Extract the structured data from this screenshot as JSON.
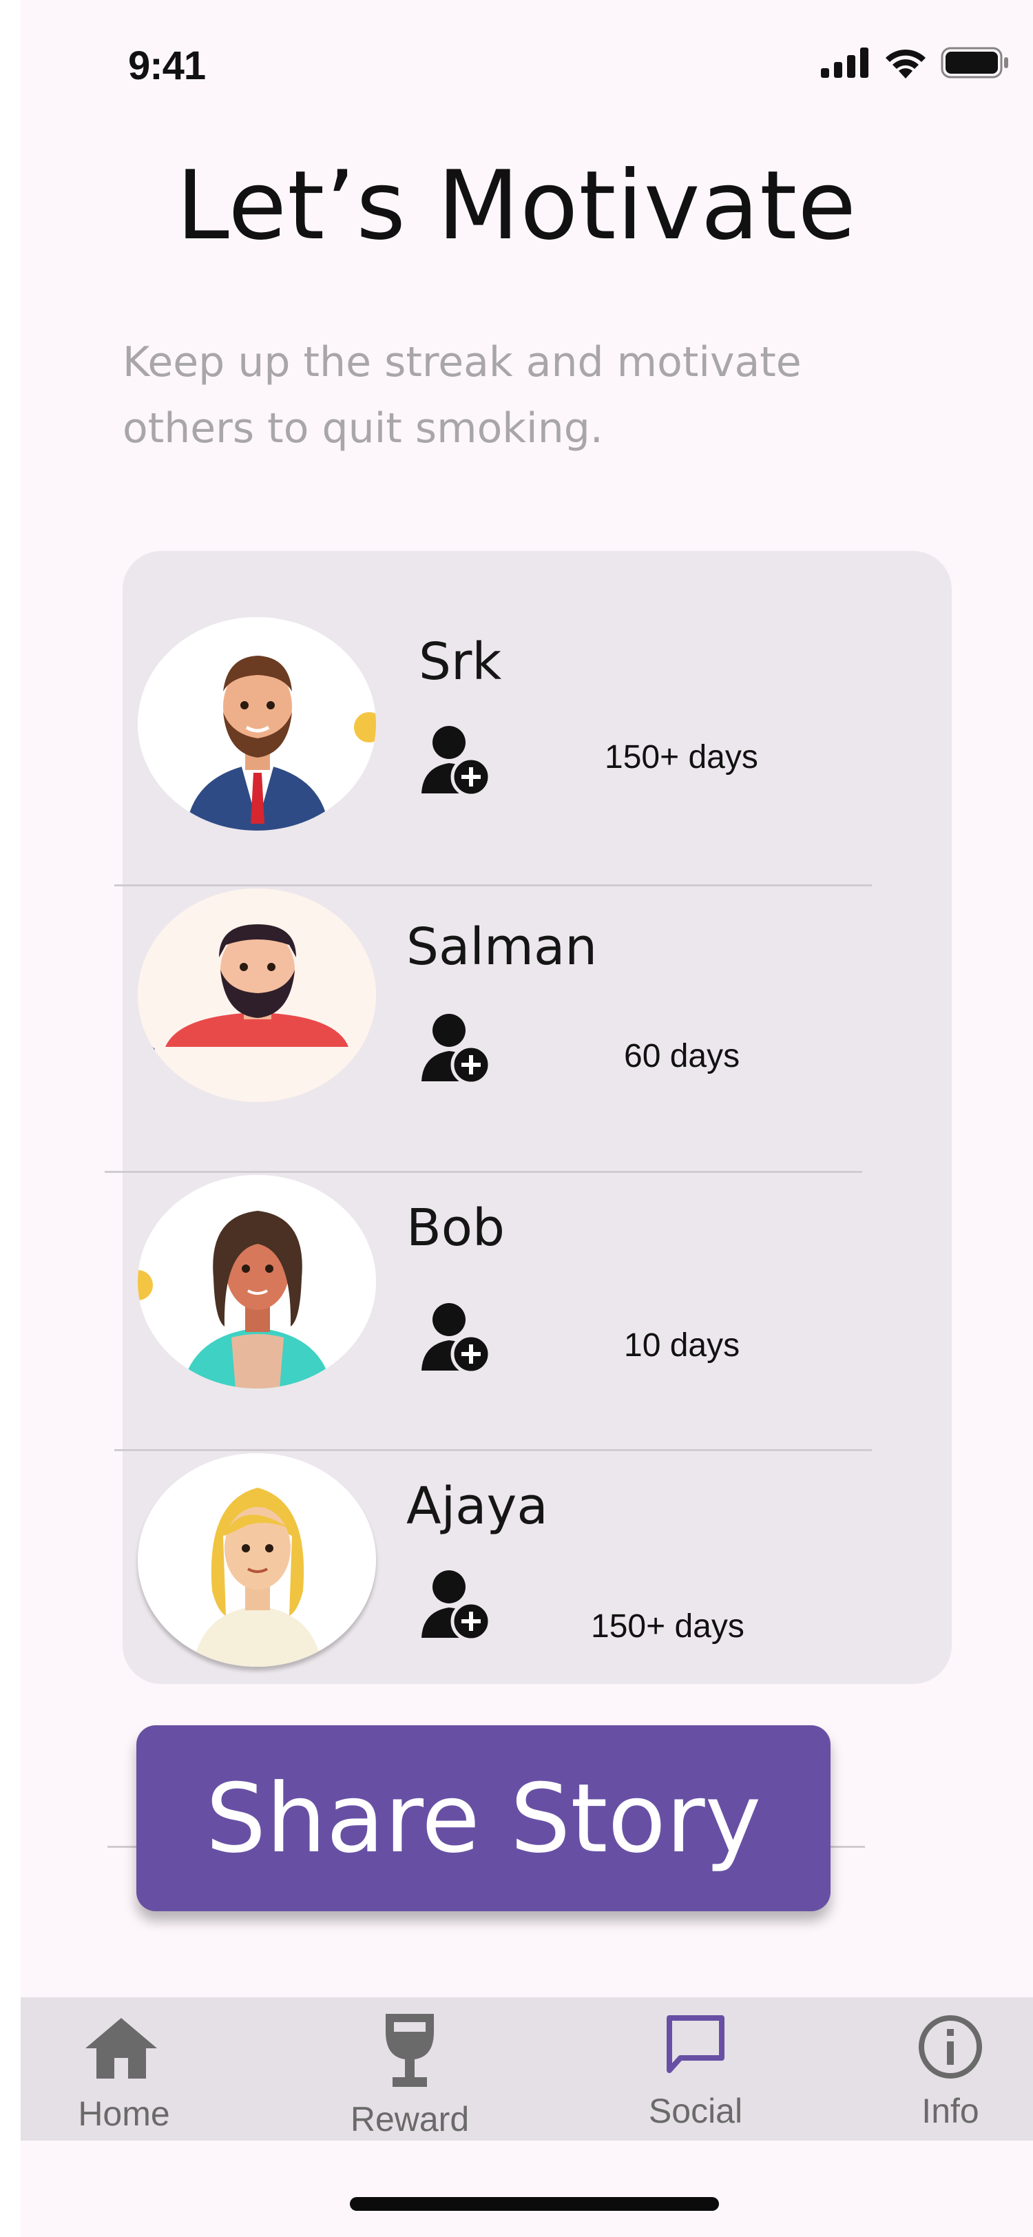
{
  "status_bar": {
    "time": "9:41"
  },
  "header": {
    "title": "Let’s Motivate",
    "subtitle": "Keep up the streak and motivate others to quit smoking."
  },
  "friends": [
    {
      "name": "Srk",
      "streak": "150+ days",
      "avatar": "man-bearded-suit-avatar"
    },
    {
      "name": "Salman",
      "streak": "60 days",
      "avatar": "man-bearded-red-shirt-avatar"
    },
    {
      "name": "Bob",
      "streak": "10 days",
      "avatar": "curly-hair-teal-jacket-avatar"
    },
    {
      "name": "Ajaya",
      "streak": "150+ days",
      "avatar": "blonde-woman-avatar"
    }
  ],
  "actions": {
    "share_label": "Share Story"
  },
  "nav": {
    "items": [
      {
        "label": "Home",
        "icon": "home-icon",
        "active": false
      },
      {
        "label": "Reward",
        "icon": "goblet-icon",
        "active": false
      },
      {
        "label": "Social",
        "icon": "chat-bubble-icon",
        "active": true
      },
      {
        "label": "Info",
        "icon": "info-icon",
        "active": false
      }
    ]
  },
  "colors": {
    "background": "#fdf7fb",
    "card": "#ece7ec",
    "primary": "#6750a4",
    "nav_background": "#e5e0e5",
    "subtitle_text": "#a9a6a9"
  }
}
